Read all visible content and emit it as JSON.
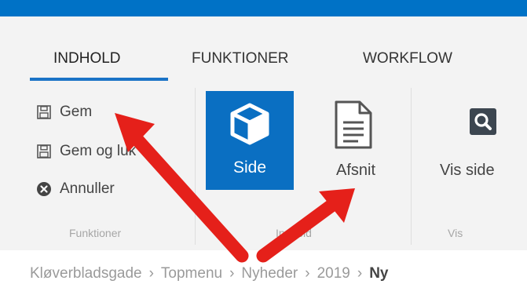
{
  "tabs": [
    {
      "label": "INDHOLD",
      "active": true
    },
    {
      "label": "FUNKTIONER",
      "active": false
    },
    {
      "label": "WORKFLOW",
      "active": false
    }
  ],
  "commands": {
    "gem": {
      "label": "Gem",
      "icon": "save-icon"
    },
    "gem_og_luk": {
      "label": "Gem og luk",
      "icon": "save-icon"
    },
    "annuller": {
      "label": "Annuller",
      "icon": "cancel-circle-icon"
    }
  },
  "groups": {
    "funktioner": "Funktioner",
    "indhold": "Indhold",
    "vis": "Vis"
  },
  "buttons": {
    "side": {
      "label": "Side",
      "icon": "cube-icon"
    },
    "afsnit": {
      "label": "Afsnit",
      "icon": "document-icon"
    },
    "vis_side": {
      "label": "Vis side",
      "icon": "magnifier-icon"
    }
  },
  "breadcrumb": [
    "Kløverbladsgade",
    "Topmenu",
    "Nyheder",
    "2019",
    "Ny"
  ],
  "colors": {
    "brand_blue": "#0072c6",
    "selected_button": "#0a6fc2",
    "annotation_arrow": "#e5201a"
  }
}
